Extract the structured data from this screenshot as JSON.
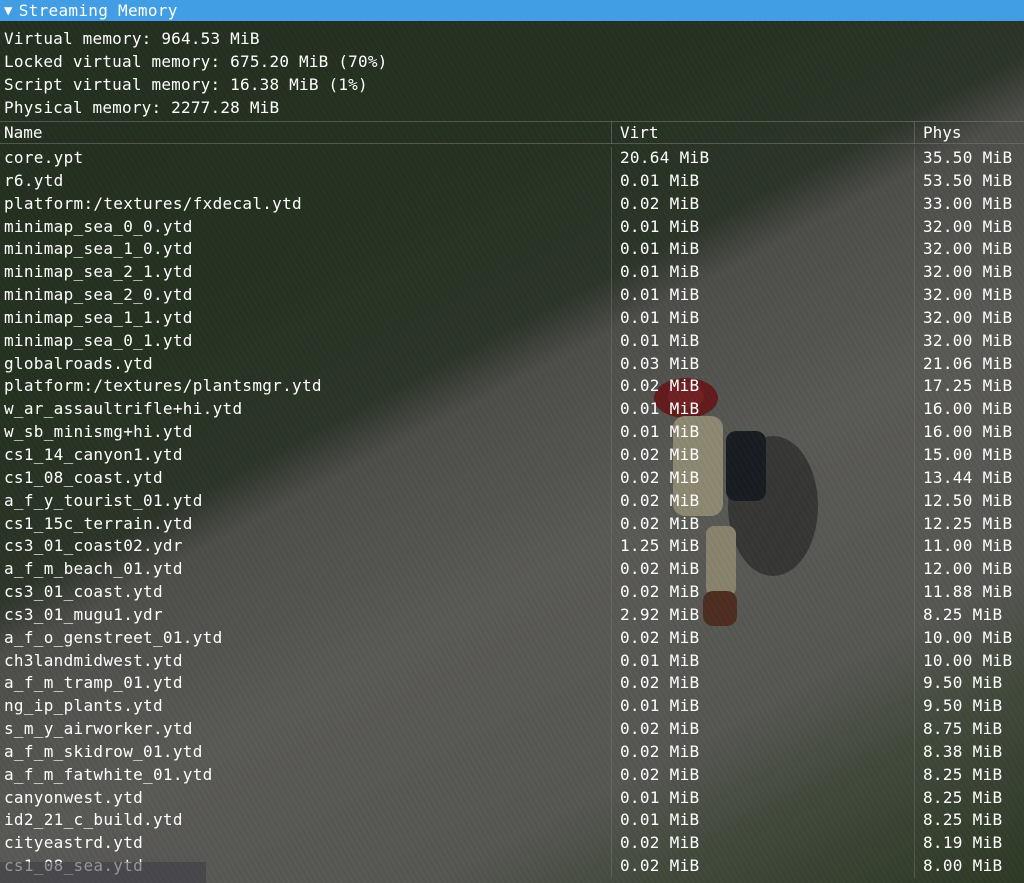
{
  "window": {
    "title": "Streaming Memory",
    "collapse_icon": "triangle-down-icon"
  },
  "summary": {
    "virtual": "Virtual memory: 964.53 MiB",
    "locked": "Locked virtual memory: 675.20 MiB (70%)",
    "script": "Script virtual memory: 16.38 MiB (1%)",
    "physical": "Physical memory: 2277.28 MiB"
  },
  "table": {
    "headers": {
      "name": "Name",
      "virt": "Virt",
      "phys": "Phys"
    },
    "rows": [
      {
        "name": "core.ypt",
        "virt": "20.64 MiB",
        "phys": "35.50 MiB"
      },
      {
        "name": "r6.ytd",
        "virt": "0.01 MiB",
        "phys": "53.50 MiB"
      },
      {
        "name": "platform:/textures/fxdecal.ytd",
        "virt": "0.02 MiB",
        "phys": "33.00 MiB"
      },
      {
        "name": "minimap_sea_0_0.ytd",
        "virt": "0.01 MiB",
        "phys": "32.00 MiB"
      },
      {
        "name": "minimap_sea_1_0.ytd",
        "virt": "0.01 MiB",
        "phys": "32.00 MiB"
      },
      {
        "name": "minimap_sea_2_1.ytd",
        "virt": "0.01 MiB",
        "phys": "32.00 MiB"
      },
      {
        "name": "minimap_sea_2_0.ytd",
        "virt": "0.01 MiB",
        "phys": "32.00 MiB"
      },
      {
        "name": "minimap_sea_1_1.ytd",
        "virt": "0.01 MiB",
        "phys": "32.00 MiB"
      },
      {
        "name": "minimap_sea_0_1.ytd",
        "virt": "0.01 MiB",
        "phys": "32.00 MiB"
      },
      {
        "name": "globalroads.ytd",
        "virt": "0.03 MiB",
        "phys": "21.06 MiB"
      },
      {
        "name": "platform:/textures/plantsmgr.ytd",
        "virt": "0.02 MiB",
        "phys": "17.25 MiB"
      },
      {
        "name": "w_ar_assaultrifle+hi.ytd",
        "virt": "0.01 MiB",
        "phys": "16.00 MiB"
      },
      {
        "name": "w_sb_minismg+hi.ytd",
        "virt": "0.01 MiB",
        "phys": "16.00 MiB"
      },
      {
        "name": "cs1_14_canyon1.ytd",
        "virt": "0.02 MiB",
        "phys": "15.00 MiB"
      },
      {
        "name": "cs1_08_coast.ytd",
        "virt": "0.02 MiB",
        "phys": "13.44 MiB"
      },
      {
        "name": "a_f_y_tourist_01.ytd",
        "virt": "0.02 MiB",
        "phys": "12.50 MiB"
      },
      {
        "name": "cs1_15c_terrain.ytd",
        "virt": "0.02 MiB",
        "phys": "12.25 MiB"
      },
      {
        "name": "cs3_01_coast02.ydr",
        "virt": "1.25 MiB",
        "phys": "11.00 MiB"
      },
      {
        "name": "a_f_m_beach_01.ytd",
        "virt": "0.02 MiB",
        "phys": "12.00 MiB"
      },
      {
        "name": "cs3_01_coast.ytd",
        "virt": "0.02 MiB",
        "phys": "11.88 MiB"
      },
      {
        "name": "cs3_01_mugu1.ydr",
        "virt": "2.92 MiB",
        "phys": "8.25 MiB"
      },
      {
        "name": "a_f_o_genstreet_01.ytd",
        "virt": "0.02 MiB",
        "phys": "10.00 MiB"
      },
      {
        "name": "ch3landmidwest.ytd",
        "virt": "0.01 MiB",
        "phys": "10.00 MiB"
      },
      {
        "name": "a_f_m_tramp_01.ytd",
        "virt": "0.02 MiB",
        "phys": "9.50 MiB"
      },
      {
        "name": "ng_ip_plants.ytd",
        "virt": "0.01 MiB",
        "phys": "9.50 MiB"
      },
      {
        "name": "s_m_y_airworker.ytd",
        "virt": "0.02 MiB",
        "phys": "8.75 MiB"
      },
      {
        "name": "a_f_m_skidrow_01.ytd",
        "virt": "0.02 MiB",
        "phys": "8.38 MiB"
      },
      {
        "name": "a_f_m_fatwhite_01.ytd",
        "virt": "0.02 MiB",
        "phys": "8.25 MiB"
      },
      {
        "name": "canyonwest.ytd",
        "virt": "0.01 MiB",
        "phys": "8.25 MiB"
      },
      {
        "name": "id2_21_c_build.ytd",
        "virt": "0.01 MiB",
        "phys": "8.25 MiB"
      },
      {
        "name": "cityeastrd.ytd",
        "virt": "0.02 MiB",
        "phys": "8.19 MiB"
      },
      {
        "name": "cs1_08_sea.ytd",
        "virt": "0.02 MiB",
        "phys": "8.00 MiB"
      }
    ]
  },
  "colors": {
    "titlebar": "#429ee4",
    "text": "#ffffff"
  }
}
